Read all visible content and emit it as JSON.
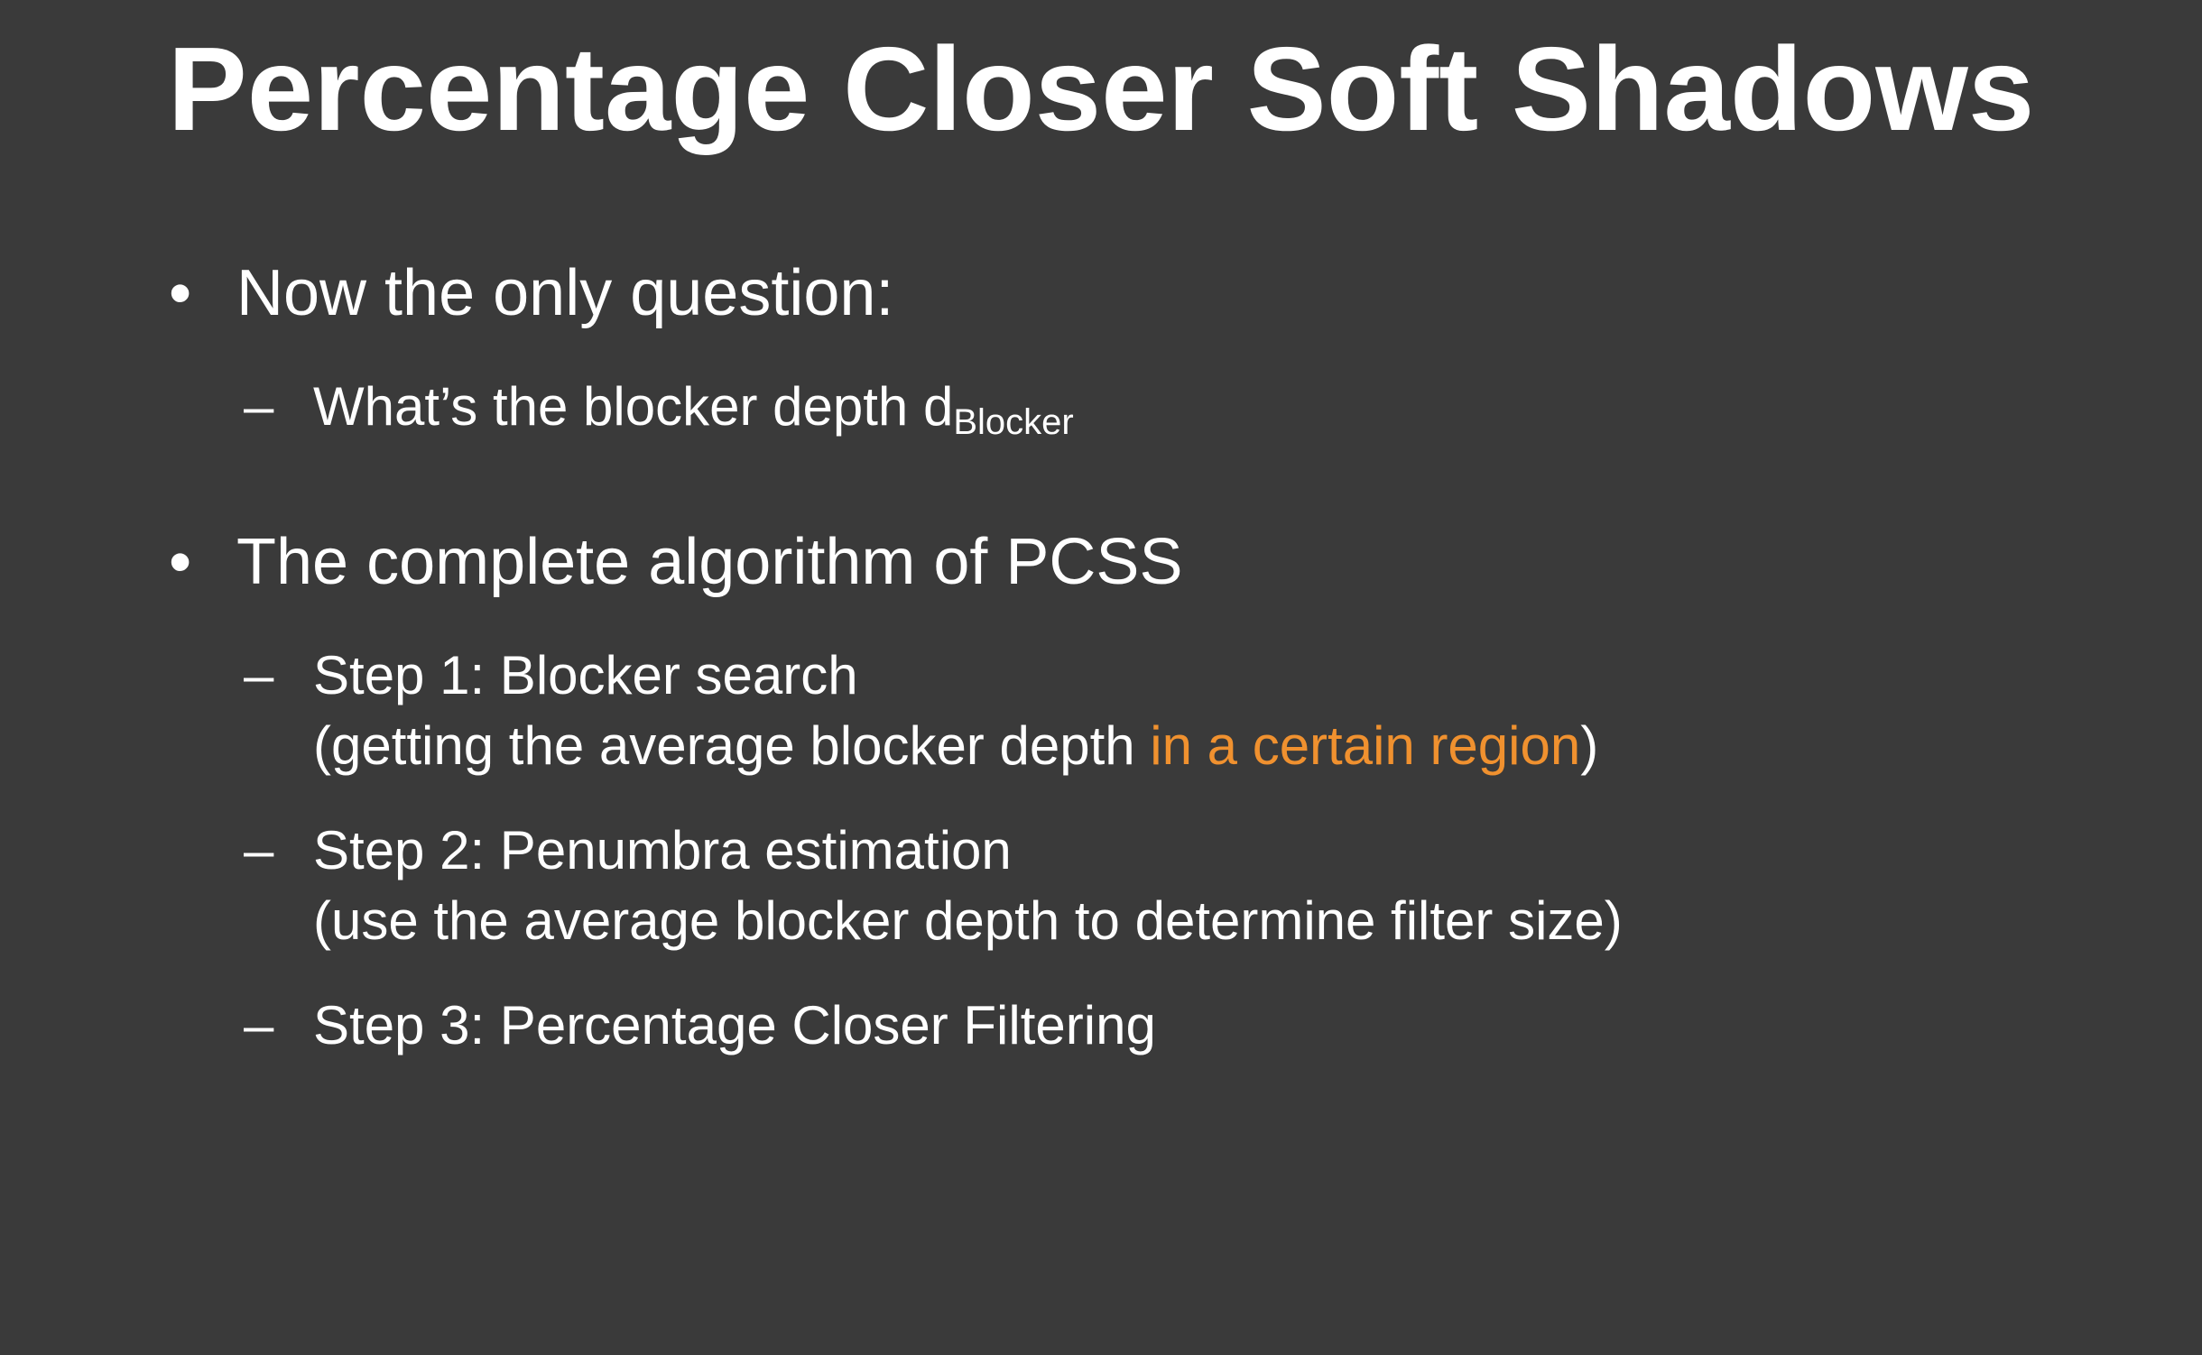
{
  "slide": {
    "title": "Percentage Closer Soft Shadows",
    "accent_color": "#f0912f",
    "bullets": [
      {
        "marker": "•",
        "text": "Now the only question:",
        "subitems": [
          {
            "marker": "–",
            "text": "What’s the blocker depth d",
            "subscript": "Blocker"
          }
        ]
      },
      {
        "marker": "•",
        "text": "The complete algorithm of PCSS",
        "subitems": [
          {
            "marker": "–",
            "line1": "Step 1: Blocker search",
            "line2_prefix": "(getting the average blocker depth ",
            "line2_highlight": "in a certain region",
            "line2_suffix": ")"
          },
          {
            "marker": "–",
            "line1": "Step 2: Penumbra estimation",
            "line2": "(use the average blocker depth to determine filter size)"
          },
          {
            "marker": "–",
            "line1": "Step 3: Percentage Closer Filtering"
          }
        ]
      }
    ]
  }
}
